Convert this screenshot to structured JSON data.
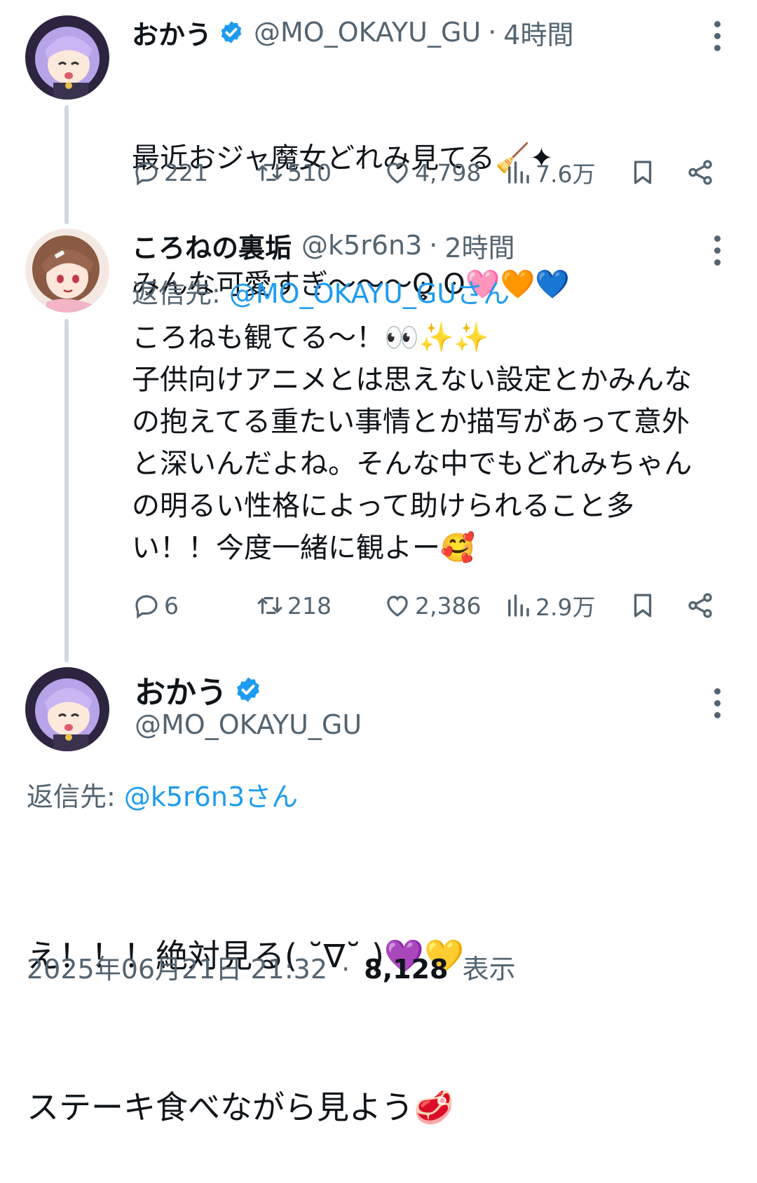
{
  "tweet1": {
    "name": "おかう",
    "handle": "@MO_OKAYU_GU",
    "time": "4時間",
    "text_line1": "最近おジャ魔女どれみ見てる🧹✦",
    "text_line2": "みんな可愛すぎ〜〜〜ʘ̥̮̥ ʘ🩷🧡💙",
    "replies": "221",
    "retweets": "510",
    "likes": "4,798",
    "views": "7.6万"
  },
  "tweet2": {
    "name": "ころねの裏垢",
    "handle": "@k5r6n3",
    "time": "2時間",
    "reply_prefix": "返信先: ",
    "reply_target": "@MO_OKAYU_GUさん",
    "text": "ころねも観てる〜！👀✨✨\n子供向けアニメとは思えない設定とかみんなの抱えてる重たい事情とか描写があって意外と深いんだよね。そんな中でもどれみちゃんの明るい性格によって助けられること多い！！今度一緒に観よー🥰",
    "replies": "6",
    "retweets": "218",
    "likes": "2,386",
    "views": "2.9万"
  },
  "main_tweet": {
    "name": "おかう",
    "handle": "@MO_OKAYU_GU",
    "reply_prefix": "返信先: ",
    "reply_target": "@k5r6n3さん",
    "text_line1": "え！！！絶対見る( ˘∇˘ )💜💛",
    "text_line2": "ステーキ食べながら見よう🥩",
    "timestamp": "2025年06月21日 21:32",
    "separator": "·",
    "view_count": "8,128",
    "view_label": "表示"
  },
  "colors": {
    "accent": "#1d9bf0",
    "secondary_text": "#536471",
    "primary_text": "#0f1419",
    "thread_line": "#cfd9de"
  }
}
